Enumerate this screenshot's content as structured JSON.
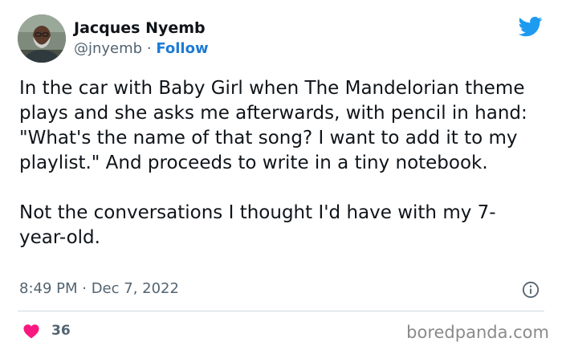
{
  "author": {
    "name": "Jacques Nyemb",
    "handle": "@jnyemb",
    "separator": "·",
    "follow_label": "Follow"
  },
  "tweet": {
    "paragraphs": [
      "In the car with Baby Girl when The Mandelorian theme plays and she asks me afterwards, with pencil in hand: \"What's the name of that song? I want to add it to my playlist.\" And proceeds to write in a tiny notebook.",
      "Not the conversations I thought I'd have with my 7-year-old."
    ],
    "timestamp": "8:49 PM · Dec 7, 2022",
    "likes": "36"
  },
  "watermark": "boredpanda.com",
  "icons": {
    "brand": "twitter-bird-icon",
    "info": "info-icon",
    "like": "heart-icon"
  },
  "colors": {
    "brand_blue": "#1d9bf0",
    "follow_blue": "#1d7bd6",
    "heart_pink": "#f91880",
    "text_primary": "#0f1419",
    "text_secondary": "#536471",
    "divider": "#cfd9de",
    "watermark": "#8a8a8a"
  }
}
